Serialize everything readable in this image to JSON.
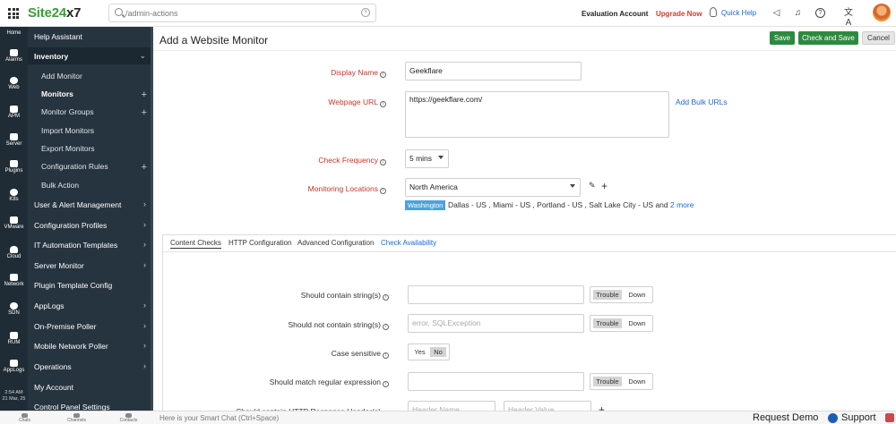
{
  "brand": {
    "logo_main": "Site24",
    "logo_accent": "x7"
  },
  "search": {
    "value": "/admin-actions",
    "placeholder": ""
  },
  "header": {
    "account": "Evaluation Account",
    "upgrade": "Upgrade Now",
    "quick_help": "Quick Help"
  },
  "rail": {
    "items": [
      "Home",
      "Alarms",
      "Web",
      "APM",
      "Server",
      "Plugins",
      "K8s",
      "VMware",
      "Cloud",
      "Network",
      "SDN",
      "RUM",
      "AppLogs"
    ],
    "time": "2:54 AM",
    "date": "21 Mar, 25"
  },
  "menu": {
    "help_assistant": "Help Assistant",
    "inventory": "Inventory",
    "add_monitor": "Add Monitor",
    "monitors": "Monitors",
    "monitor_groups": "Monitor Groups",
    "import_monitors": "Import Monitors",
    "export_monitors": "Export Monitors",
    "configuration_rules": "Configuration Rules",
    "bulk_action": "Bulk Action",
    "user_alert": "User & Alert Management",
    "config_profiles": "Configuration Profiles",
    "it_automation": "IT Automation Templates",
    "server_monitor": "Server Monitor",
    "plugin_template": "Plugin Template Config",
    "applogs": "AppLogs",
    "onprem_poller": "On-Premise Poller",
    "mobile_poller": "Mobile Network Poller",
    "operations": "Operations",
    "my_account": "My Account",
    "control_panel": "Control Panel Settings"
  },
  "bottom": {
    "tabs": [
      "Chats",
      "Channels",
      "Contacts"
    ],
    "smart_chat": "Here is your Smart Chat (Ctrl+Space)",
    "request_demo": "Request Demo",
    "support": "Support"
  },
  "page": {
    "title": "Add a Website Monitor",
    "save": "Save",
    "check_and_save": "Check and Save",
    "cancel": "Cancel"
  },
  "form": {
    "display_name_label": "Display Name",
    "display_name_value": "Geekflare",
    "webpage_url_label": "Webpage URL",
    "webpage_url_value": "https://geekflare.com/",
    "add_bulk_urls": "Add Bulk URLs",
    "check_frequency_label": "Check Frequency",
    "check_frequency_value": "5 mins",
    "monitoring_locations_label": "Monitoring Locations",
    "monitoring_locations_value": "North America",
    "location_badge": "Washington",
    "location_list": "Dallas - US , Miami - US , Portland - US , Salt Lake City - US and",
    "more_link": "2 more"
  },
  "tabs": [
    "Content Checks",
    "HTTP Configuration",
    "Advanced Configuration",
    "Check Availability"
  ],
  "checks": {
    "should_contain": "Should contain string(s)",
    "should_not_contain": "Should not contain string(s)",
    "should_not_placeholder": "error, SQLException",
    "case_sensitive": "Case sensitive",
    "regex": "Should match regular expression",
    "http_header": "Should contain HTTP Response Header(s)",
    "header_name_placeholder": "Header Name",
    "header_value_placeholder": "Header Value",
    "trouble": "Trouble",
    "down": "Down",
    "yes": "Yes",
    "no": "No"
  }
}
